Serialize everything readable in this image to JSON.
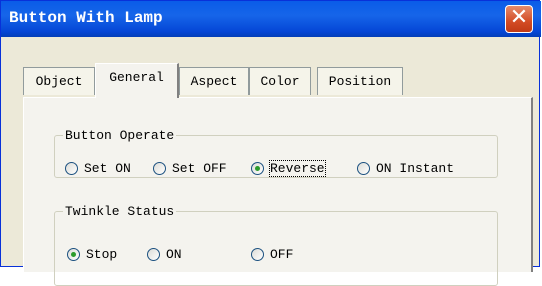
{
  "window": {
    "title": "Button With Lamp",
    "close_glyph": "✕"
  },
  "tabs": [
    {
      "label": "Object"
    },
    {
      "label": "General"
    },
    {
      "label": "Aspect"
    },
    {
      "label": "Color"
    },
    {
      "label": "Position"
    }
  ],
  "active_tab": "General",
  "button_operate": {
    "legend": "Button Operate",
    "options": [
      {
        "label": "Set ON",
        "selected": false
      },
      {
        "label": "Set OFF",
        "selected": false
      },
      {
        "label": "Reverse",
        "selected": true
      },
      {
        "label": "ON Instant",
        "selected": false
      }
    ]
  },
  "twinkle_status": {
    "legend": "Twinkle Status",
    "options": [
      {
        "label": "Stop",
        "selected": true
      },
      {
        "label": "ON",
        "selected": false
      },
      {
        "label": "OFF",
        "selected": false
      }
    ]
  },
  "colors": {
    "title_bar": "#0a5ce8",
    "close_button": "#d34c25",
    "dialog_bg": "#ece9d8",
    "radio_selected": "#2b9b2b"
  },
  "icons": {
    "close": "close-icon",
    "radio": "radio-icon"
  }
}
